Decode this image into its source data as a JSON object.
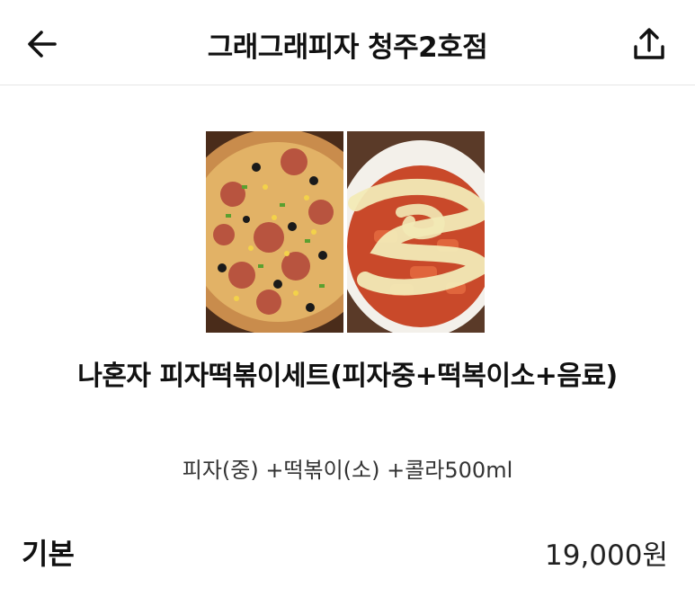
{
  "header": {
    "title": "그래그래피자 청주2호점",
    "back_icon": "arrow-left-icon",
    "share_icon": "share-upload-icon"
  },
  "product": {
    "name": "나혼자 피자떡볶이세트(피자중+떡복이소+음료)",
    "description": "피자(중) +떡볶이(소) +콜라500ml",
    "images": [
      "pizza-photo",
      "tteokbokki-photo"
    ]
  },
  "pricing": {
    "label": "기본",
    "value": "19,000원"
  }
}
